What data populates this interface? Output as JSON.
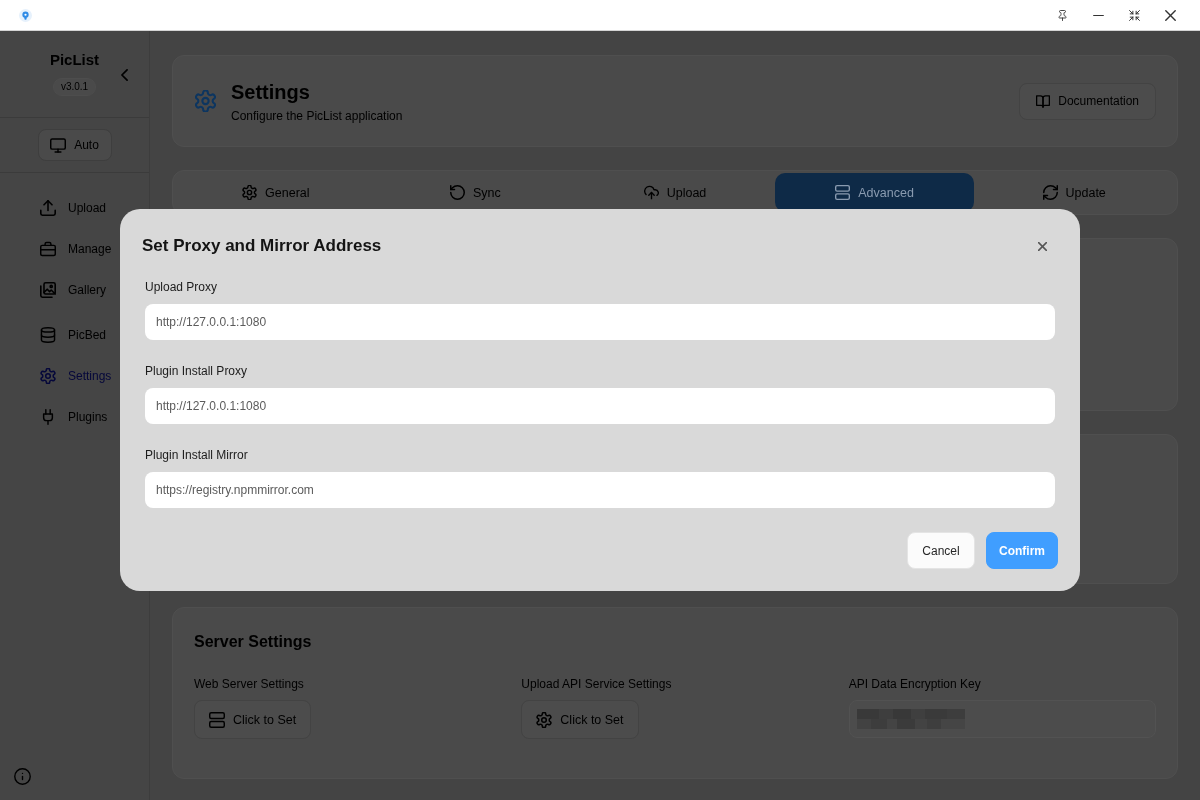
{
  "sidebar": {
    "app_name": "PicList",
    "version": "v3.0.1",
    "theme_button": "Auto",
    "items": [
      {
        "label": "Upload",
        "kind": "link",
        "selected": false
      },
      {
        "label": "Manage",
        "kind": "link",
        "selected": false
      },
      {
        "label": "Gallery",
        "kind": "link",
        "selected": false
      },
      {
        "label": "PicBed",
        "kind": "group",
        "selected": false
      },
      {
        "label": "Settings",
        "kind": "link",
        "selected": true
      },
      {
        "label": "Plugins",
        "kind": "link",
        "selected": false
      }
    ]
  },
  "header": {
    "title": "Settings",
    "subtitle": "Configure the PicList application",
    "docs_button": "Documentation"
  },
  "tabs": [
    {
      "label": "General",
      "selected": false
    },
    {
      "label": "Sync",
      "selected": false
    },
    {
      "label": "Upload",
      "selected": false
    },
    {
      "label": "Advanced",
      "selected": true
    },
    {
      "label": "Update",
      "selected": false
    }
  ],
  "server_settings": {
    "title": "Server Settings",
    "items": [
      {
        "label": "Web Server Settings",
        "kind": "button",
        "button": "Click to Set"
      },
      {
        "label": "Upload API Service Settings",
        "kind": "button",
        "button": "Click to Set"
      },
      {
        "label": "API Data Encryption Key",
        "kind": "secret"
      }
    ]
  },
  "dialog": {
    "title": "Set Proxy and Mirror Address",
    "fields": [
      {
        "label": "Upload Proxy",
        "value": "http://127.0.0.1:1080"
      },
      {
        "label": "Plugin Install Proxy",
        "value": "http://127.0.0.1:1080"
      },
      {
        "label": "Plugin Install Mirror",
        "value": "https://registry.npmmirror.com"
      }
    ],
    "buttons": [
      {
        "label": "Cancel",
        "kind": "secondary"
      },
      {
        "label": "Confirm",
        "kind": "primary"
      }
    ]
  }
}
